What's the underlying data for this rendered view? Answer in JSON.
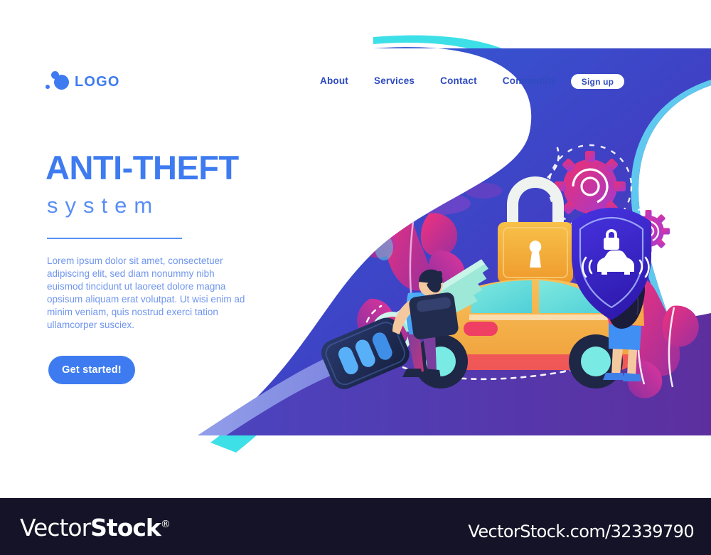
{
  "brand": {
    "logo_text": "LOGO",
    "logo_icon": "dots-logo-icon",
    "accent_blue": "#3e7bf0",
    "nav_blue": "#2f4bbf",
    "body_blue": "#6f95ee"
  },
  "nav": {
    "items": [
      {
        "label": "About"
      },
      {
        "label": "Services"
      },
      {
        "label": "Contact"
      },
      {
        "label": "Community"
      }
    ],
    "signup_label": "Sign up"
  },
  "hero": {
    "title": "ANTI-THEFT",
    "subtitle": "system",
    "body": "Lorem ipsum dolor sit amet, consectetuer adipiscing elit, sed diam nonummy nibh euismod tincidunt ut laoreet dolore magna opsisum aliquam erat volutpat. Ut wisi enim ad minim veniam, quis nostrud exerci tation ullamcorper susciex.",
    "cta_label": "Get started!"
  },
  "illustration": {
    "scene_name": "anti-theft-car-security-illustration",
    "elements": [
      {
        "name": "padlock-icon",
        "color": "#f0a82e"
      },
      {
        "name": "security-shield-icon",
        "color": "#3a25c9"
      },
      {
        "name": "shield-lock-glyph",
        "color": "#ffffff"
      },
      {
        "name": "shield-car-signal-glyph",
        "color": "#ffffff"
      },
      {
        "name": "gear-large-icon",
        "color": "#e8358a"
      },
      {
        "name": "gear-small-icon",
        "color": "#c034c9"
      },
      {
        "name": "car-illustration",
        "color": "#f5b041"
      },
      {
        "name": "car-key-fob-icon",
        "color": "#1f2f5c"
      },
      {
        "name": "man-character",
        "color": "#3fa2f7"
      },
      {
        "name": "woman-character",
        "color": "#f5a947"
      },
      {
        "name": "leaf-plant-decoration",
        "color": "#e8358a"
      },
      {
        "name": "dashed-signal-path",
        "color": "#ffffff"
      }
    ],
    "background": {
      "blue_wave": "#3a55cc",
      "cyan_edge": "#3ee0e8",
      "purple_wave": "#5b3fb0",
      "periwinkle_edge": "#8a9be8"
    }
  },
  "watermark": {
    "name_light": "Vector",
    "name_bold": "Stock",
    "registered": "®",
    "url": "VectorStock.com/32339790"
  }
}
